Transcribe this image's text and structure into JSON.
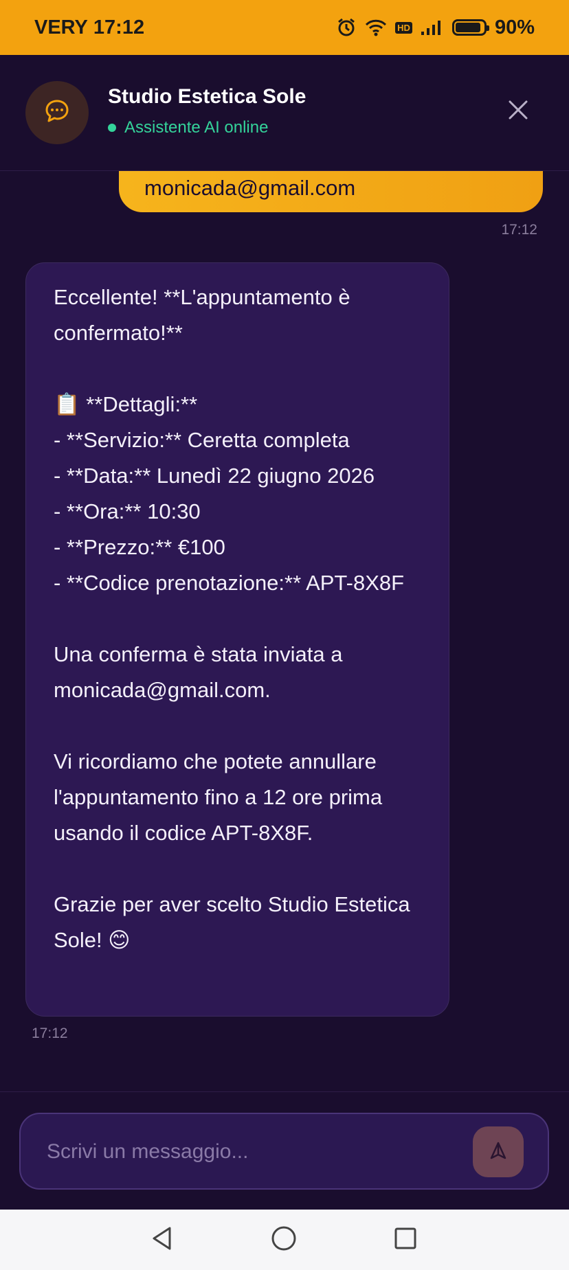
{
  "status_bar": {
    "carrier": "VERY",
    "time": "17:12",
    "hd_label": "HD",
    "battery": "90%",
    "battery_level": 0.9,
    "icons": [
      "alarm-icon",
      "wifi-icon",
      "hd-icon",
      "signal-icon",
      "battery-icon"
    ]
  },
  "header": {
    "title": "Studio Estetica Sole",
    "status": "Assistente AI online",
    "avatar_icon": "chat-bubble-icon",
    "close_icon": "close-icon"
  },
  "messages": {
    "user_text": "monicada@gmail.com",
    "user_time": "17:12",
    "bot_text": "Eccellente! **L'appuntamento è confermato!**\n\n📋 **Dettagli:**\n- **Servizio:** Ceretta completa\n- **Data:** Lunedì 22 giugno 2026\n- **Ora:** 10:30\n- **Prezzo:** €100\n- **Codice prenotazione:** APT-8X8F\n\nUna conferma è stata inviata a monicada@gmail.com.\n\nVi ricordiamo che potete annullare l'appuntamento fino a 12 ore prima usando il codice APT-8X8F.\n\nGrazie per aver scelto Studio Estetica Sole! 😊",
    "bot_time": "17:12"
  },
  "composer": {
    "placeholder": "Scrivi un messaggio...",
    "value": "",
    "send_icon": "send-icon"
  },
  "nav": {
    "icons": [
      "back-icon",
      "home-icon",
      "recents-icon"
    ]
  },
  "colors": {
    "accent": "#f3a20f",
    "background": "#1a0d2e",
    "bot_bubble": "#2d1853",
    "online": "#34d39a"
  }
}
